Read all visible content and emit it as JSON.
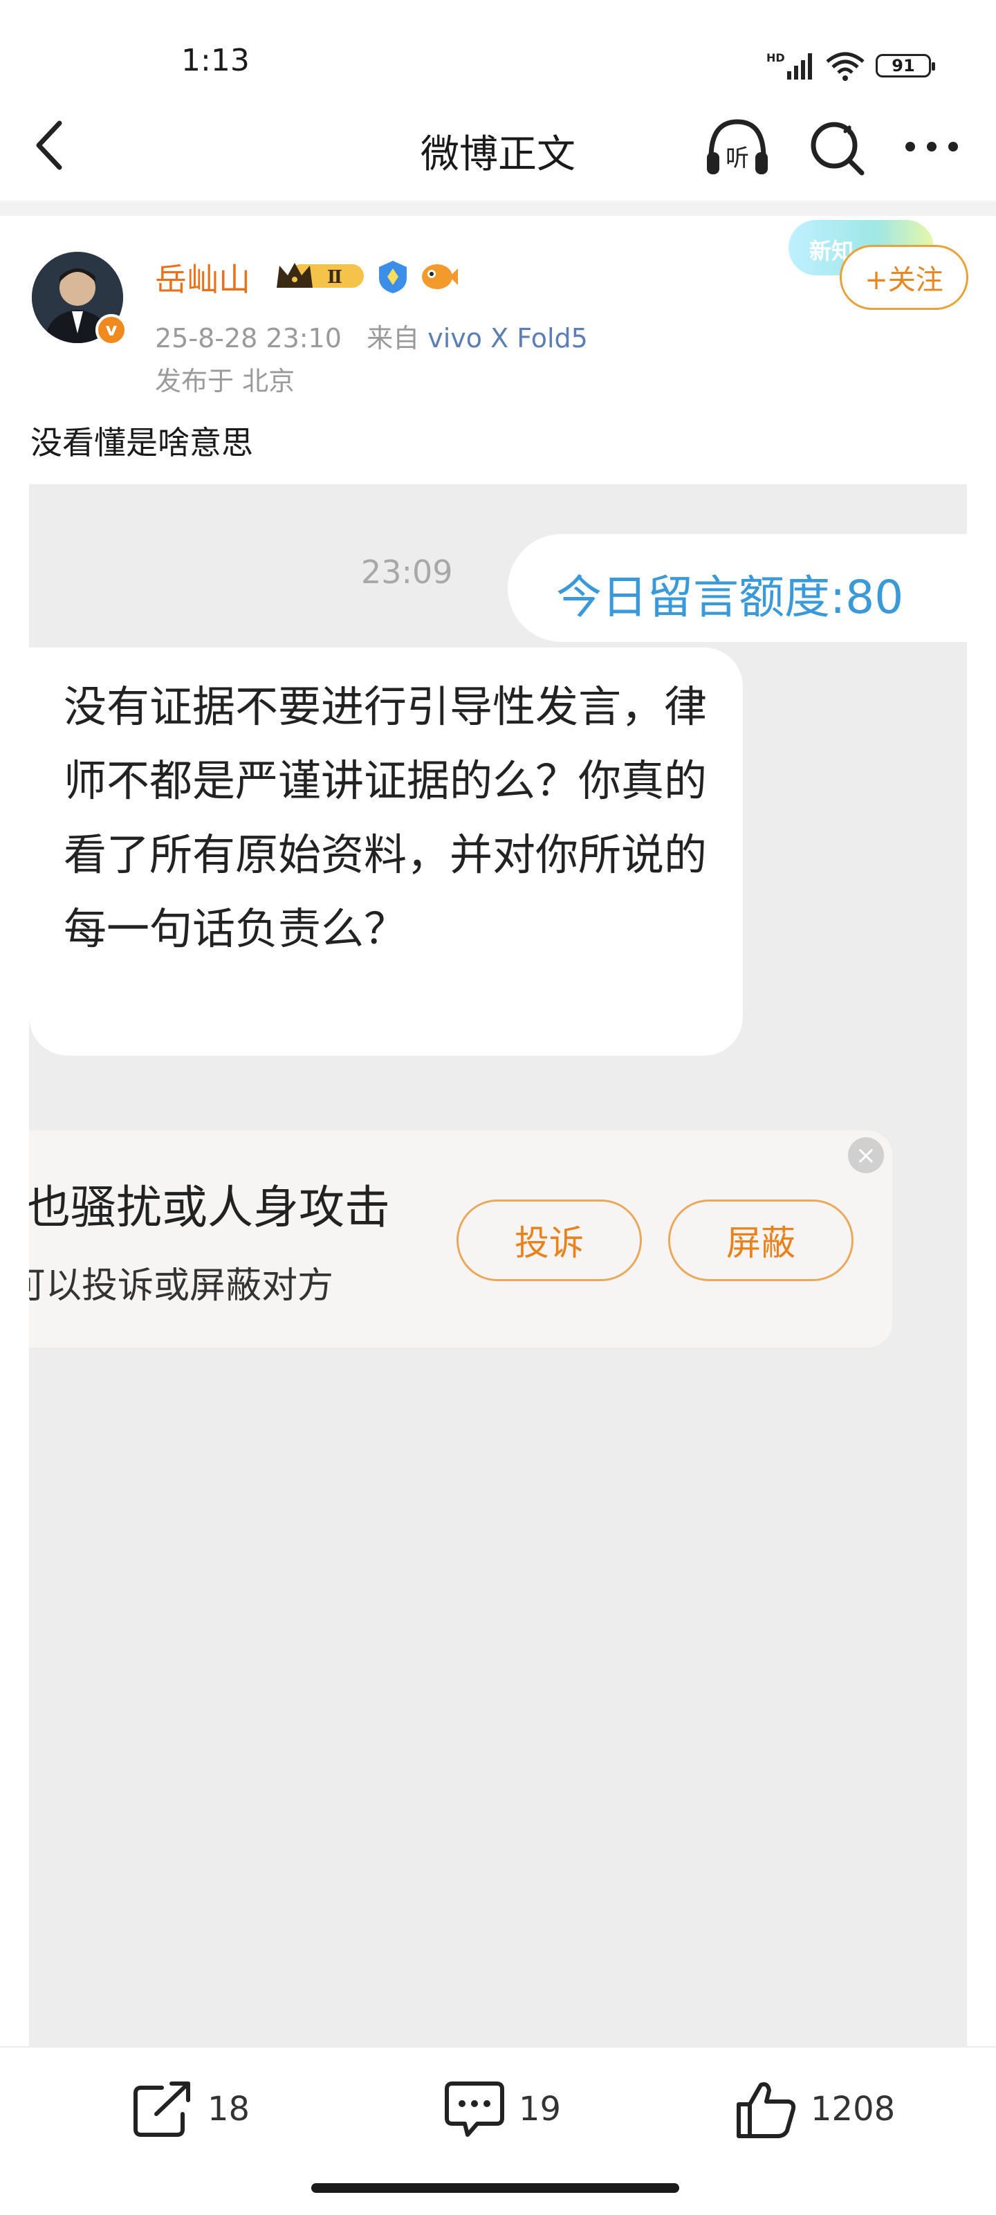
{
  "status_bar": {
    "time": "1:13",
    "battery": "91",
    "network": "HD"
  },
  "nav": {
    "title": "微博正文",
    "listen_label": "听"
  },
  "post": {
    "username": "岳屾山",
    "rank_badge": "Ⅱ",
    "verified_badge": "v",
    "date": "25-8-28 23:10",
    "source_prefix": "来自",
    "device": "vivo X Fold5",
    "location": "发布于 北京",
    "banner_text": "新知",
    "follow_label": "+关注",
    "text": "没看懂是啥意思"
  },
  "screenshot": {
    "time": "23:09",
    "sent_message": "今日留言额度:80",
    "received_message": "没有证据不要进行引导性发言，律师不都是严谨讲证据的么？你真的看了所有原始资料，并对你所说的每一句话负责么？",
    "warning_title": "也骚扰或人身攻击",
    "warning_sub": "可以投诉或屏蔽对方",
    "report_label": "投诉",
    "block_label": "屏蔽"
  },
  "actions": {
    "shares": "18",
    "comments": "19",
    "likes": "1208"
  }
}
